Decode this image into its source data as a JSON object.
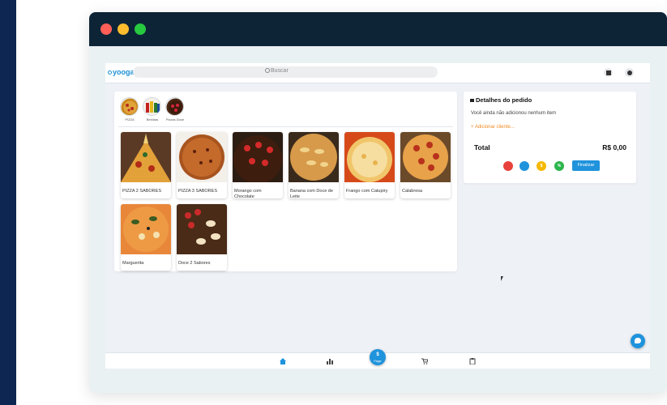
{
  "window": {
    "controls": [
      "close",
      "minimize",
      "maximize"
    ]
  },
  "header": {
    "logo": "yooga",
    "search": {
      "placeholder": "Buscar",
      "icon": "search-icon"
    },
    "icons": [
      "qr-code-icon",
      "gear-icon"
    ]
  },
  "categories": [
    {
      "label": "PIZZA"
    },
    {
      "label": "Bebidas"
    },
    {
      "label": "Pizzas Doce"
    }
  ],
  "products": [
    {
      "name": "PIZZA 2 SABORES"
    },
    {
      "name": "PIZZA 3 SABORES"
    },
    {
      "name": "Morango com Chocolate"
    },
    {
      "name": "Banana com Doce de Leite"
    },
    {
      "name": "Frango com Catupiry"
    },
    {
      "name": "Calabresa"
    },
    {
      "name": "Marguerita"
    },
    {
      "name": "Doce 2 Sabores"
    }
  ],
  "order": {
    "title": "Detalhes do pedido",
    "empty_message": "Você ainda não adicionou nenhum item",
    "add_client": "+ Adicionar cliente...",
    "total_label": "Total",
    "total_value": "R$ 0,00",
    "action_colors": [
      "#e8413c",
      "#1f93dc",
      "#f5b800",
      "#2ab54a"
    ],
    "action_icons": [
      "trash-icon",
      "home-icon",
      "dollar-icon",
      "percent-icon"
    ],
    "action_glyphs": [
      "",
      "",
      "$",
      "%"
    ],
    "finish_label": "Finalizar"
  },
  "bottom_nav": {
    "pay_symbol": "$",
    "pay_label": "Pagar",
    "icons": [
      "home-icon",
      "bar-chart-icon",
      "cart-icon",
      "clipboard-icon"
    ]
  },
  "colors": {
    "accent": "#1f93dc",
    "orange": "#f08a24",
    "titlebar": "#0d2437"
  }
}
